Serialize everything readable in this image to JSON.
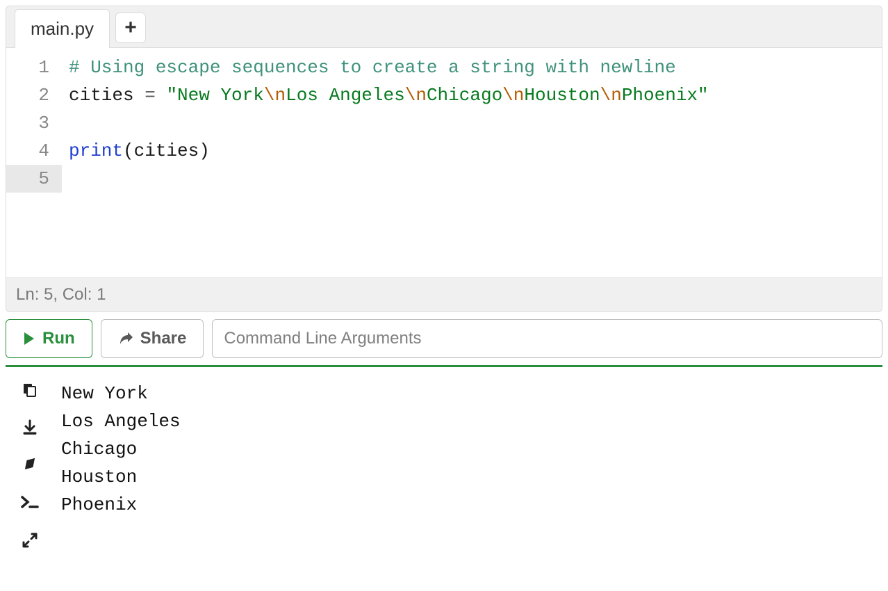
{
  "tabs": {
    "active": "main.py"
  },
  "code": {
    "lines": [
      {
        "n": "1",
        "tokens": [
          {
            "t": "# Using escape sequences to create a string with newline",
            "c": "tok-comment"
          }
        ]
      },
      {
        "n": "2",
        "tokens": [
          {
            "t": "cities ",
            "c": "tok-id"
          },
          {
            "t": "=",
            "c": "tok-op"
          },
          {
            "t": " ",
            "c": "tok-id"
          },
          {
            "t": "\"New York",
            "c": "tok-str"
          },
          {
            "t": "\\n",
            "c": "tok-esc"
          },
          {
            "t": "Los Angeles",
            "c": "tok-str"
          },
          {
            "t": "\\n",
            "c": "tok-esc"
          },
          {
            "t": "Chicago",
            "c": "tok-str"
          },
          {
            "t": "\\n",
            "c": "tok-esc"
          },
          {
            "t": "Houston",
            "c": "tok-str"
          },
          {
            "t": "\\n",
            "c": "tok-esc"
          },
          {
            "t": "Phoenix\"",
            "c": "tok-str"
          }
        ]
      },
      {
        "n": "3",
        "tokens": []
      },
      {
        "n": "4",
        "tokens": [
          {
            "t": "print",
            "c": "tok-fn"
          },
          {
            "t": "(",
            "c": "tok-paren"
          },
          {
            "t": "cities",
            "c": "tok-id"
          },
          {
            "t": ")",
            "c": "tok-paren"
          }
        ]
      },
      {
        "n": "5",
        "tokens": [],
        "active": true
      }
    ]
  },
  "status": {
    "text": "Ln: 5,  Col: 1"
  },
  "toolbar": {
    "run_label": "Run",
    "share_label": "Share",
    "cmd_placeholder": "Command Line Arguments"
  },
  "output": {
    "lines": [
      "New York",
      "Los Angeles",
      "Chicago",
      "Houston",
      "Phoenix"
    ]
  }
}
